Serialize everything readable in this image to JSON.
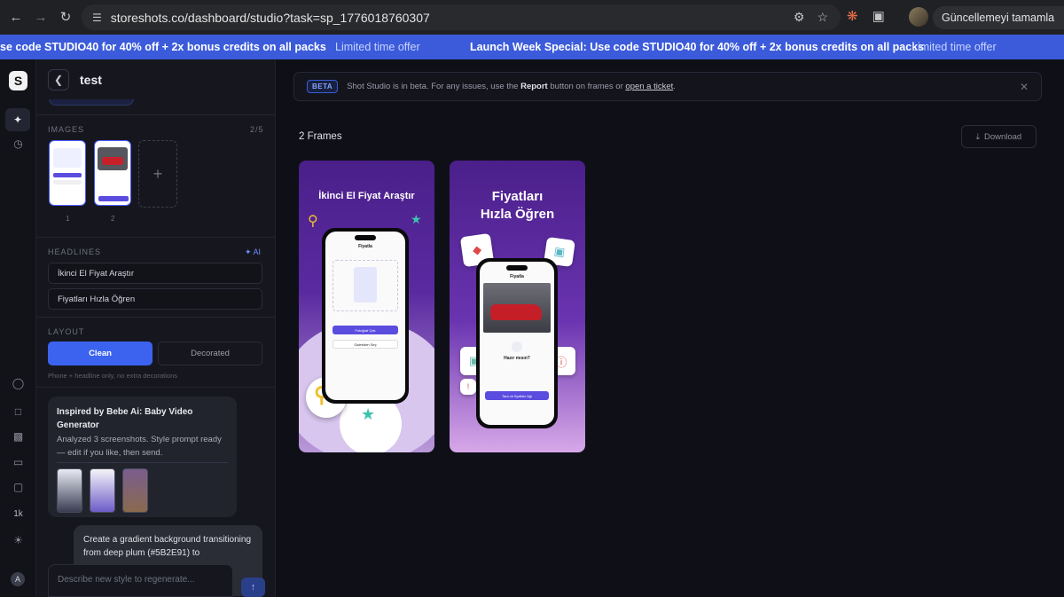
{
  "browser": {
    "url": "storeshots.co/dashboard/studio?task=sp_1776018760307",
    "update_label": "Güncellemeyi tamamla"
  },
  "banner": {
    "msg_partial": "se code STUDIO40 for 40% off + 2x bonus credits on all packs",
    "limited": "Limited time offer",
    "msg_full": "Launch Week Special: Use code STUDIO40 for 40% off + 2x bonus credits on all packs",
    "limited2": "Limited time offer"
  },
  "rail": {
    "logo": "S",
    "credits": "1k",
    "avatar": "A"
  },
  "panel": {
    "title": "test",
    "images_label": "IMAGES",
    "images_count": "2/5",
    "image_numbers": [
      "1",
      "2"
    ],
    "headlines_label": "HEADLINES",
    "ai_label": "AI",
    "headlines": [
      "İkinci El Fiyat Araştır",
      "Fiyatları Hızla Öğren"
    ],
    "layout_label": "LAYOUT",
    "layout_options": [
      "Clean",
      "Decorated"
    ],
    "layout_hint": "Phone + headline only, no extra decorations",
    "inspired": {
      "title": "Inspired by Bebe Ai: Baby Video Generator",
      "desc": "Analyzed 3 screenshots. Style prompt ready — edit if you like, then send."
    },
    "user_message": "Create a gradient background transitioning from deep plum (#5B2E91) to",
    "composer_placeholder": "Describe new style to regenerate..."
  },
  "main": {
    "beta_badge": "BETA",
    "beta_pre": "Shot Studio is in beta. For any issues, use the ",
    "beta_report": "Report",
    "beta_mid": " button on frames or ",
    "beta_link": "open a ticket",
    "beta_end": ".",
    "frames_title": "2 Frames",
    "download_label": "Download",
    "frames": [
      {
        "headline": "İkinci El Fiyat Araştır",
        "screen_title": "Fiyatla",
        "primary_btn": "Fotoğraf Çek",
        "secondary_btn": "Galeriden Seç"
      },
      {
        "headline_line1": "Fiyatları",
        "headline_line2": "Hızla Öğren",
        "screen_title": "Fiyatla",
        "question": "Hazır mısın?",
        "primary_btn": "Tara ve fiyatları öğr"
      }
    ]
  },
  "colors": {
    "accent": "#3b63f0",
    "banner": "#3b5bdb",
    "frame_purple": "#5a2aa0"
  }
}
